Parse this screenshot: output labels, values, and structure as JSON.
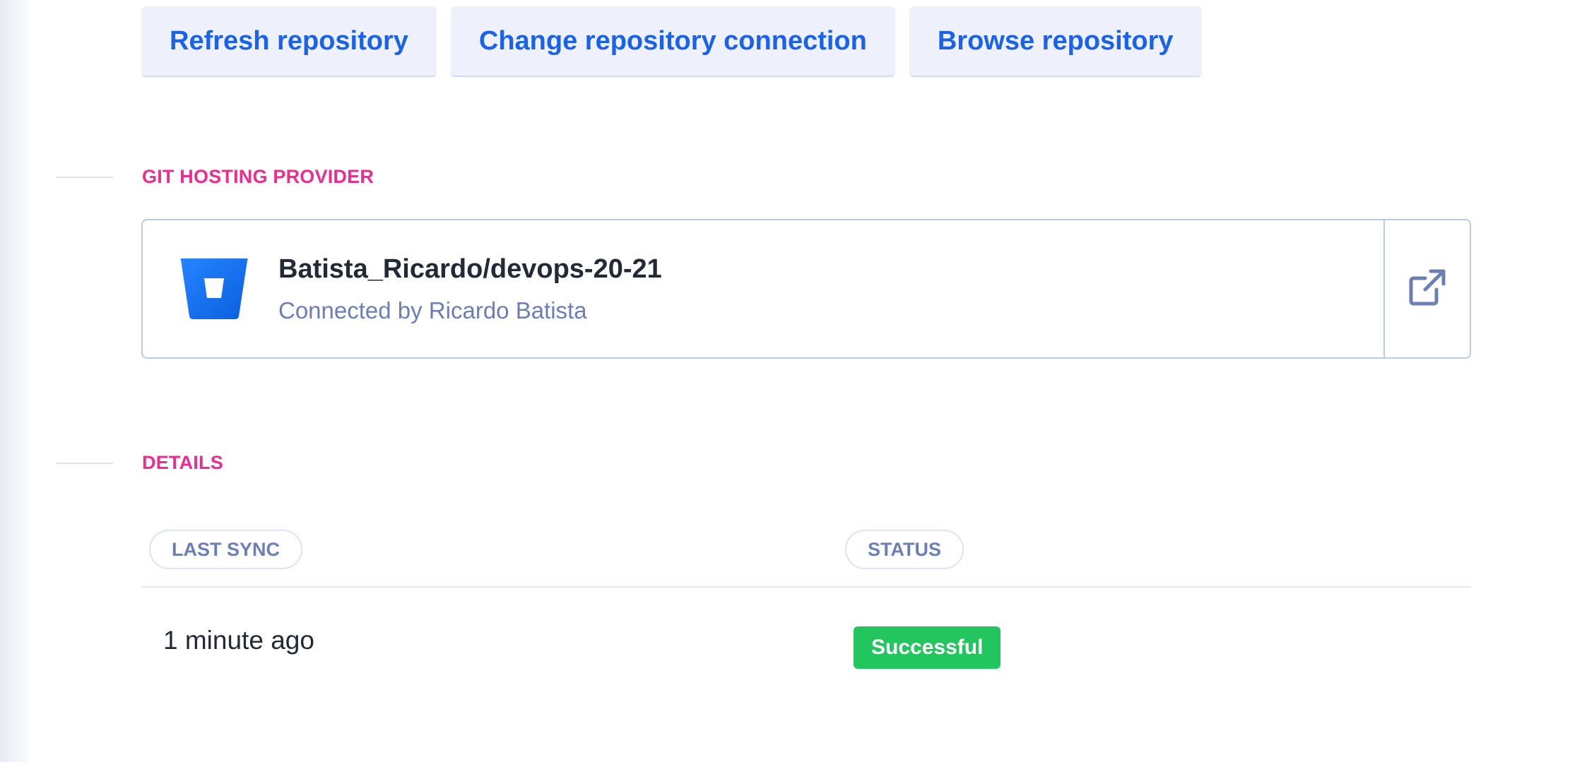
{
  "actions": {
    "refresh_label": "Refresh repository",
    "change_label": "Change repository connection",
    "browse_label": "Browse repository"
  },
  "git_section": {
    "title": "GIT HOSTING PROVIDER"
  },
  "provider": {
    "repo_name": "Batista_Ricardo/devops-20-21",
    "connected_by": "Connected by Ricardo Batista",
    "logo_icon": "bitbucket-icon",
    "link_icon": "external-link-icon",
    "brand_color": "#2684ff"
  },
  "details_section": {
    "title": "DETAILS",
    "columns": {
      "last_sync": "LAST SYNC",
      "status": "STATUS"
    },
    "row": {
      "last_sync": "1 minute ago",
      "status": "Successful"
    }
  },
  "colors": {
    "accent": "#1a62e8",
    "section_title": "#ec2d8f",
    "success": "#22c55e",
    "muted": "#6b7fb4"
  }
}
